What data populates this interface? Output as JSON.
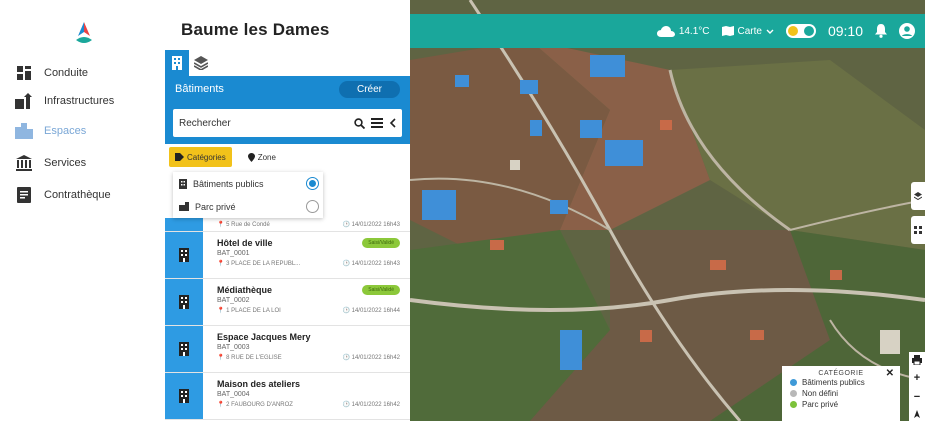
{
  "app": {
    "city": "Baume les Dames"
  },
  "nav": {
    "items": [
      {
        "label": "Conduite",
        "icon": "steering-icon"
      },
      {
        "label": "Infrastructures",
        "icon": "infrastructure-icon"
      },
      {
        "label": "Espaces",
        "icon": "spaces-icon",
        "active": true
      },
      {
        "label": "Services",
        "icon": "services-icon"
      },
      {
        "label": "Contrathèque",
        "icon": "contracts-icon"
      }
    ]
  },
  "panel": {
    "section_title": "Bâtiments",
    "create_label": "Créer",
    "search_placeholder": "Rechercher",
    "filters": {
      "categories": "Catégories",
      "zone": "Zone"
    },
    "dropdown": [
      {
        "label": "Bâtiments publics",
        "checked": true
      },
      {
        "label": "Parc privé",
        "checked": false
      }
    ],
    "first_item": {
      "addr": "5 Rue de Condé",
      "date": "14/01/2022 16h43"
    },
    "items": [
      {
        "name": "Hôtel de ville",
        "code": "BAT_0001",
        "addr": "3 PLACE DE LA REPUBL...",
        "date": "14/01/2022 16h43",
        "badge": "Saisi/Validé"
      },
      {
        "name": "Médiathèque",
        "code": "BAT_0002",
        "addr": "1 PLACE DE LA LOI",
        "date": "14/01/2022 16h44",
        "badge": "Saisi/Validé"
      },
      {
        "name": "Espace Jacques Mery",
        "code": "BAT_0003",
        "addr": "8 RUE DE L'EGLISE",
        "date": "14/01/2022 16h42",
        "badge": ""
      },
      {
        "name": "Maison des ateliers",
        "code": "BAT_0004",
        "addr": "2 FAUBOURG D'ANROZ",
        "date": "14/01/2022 16h42",
        "badge": ""
      }
    ]
  },
  "topbar": {
    "temperature": "14.1°C",
    "map_select": "Carte",
    "time": "09:10"
  },
  "legend": {
    "title": "CATÉGORIE",
    "items": [
      {
        "label": "Bâtiments publics",
        "color": "#3f9ad8"
      },
      {
        "label": "Non défini",
        "color": "#b8b8b8"
      },
      {
        "label": "Parc privé",
        "color": "#7cc23a"
      }
    ]
  },
  "colors": {
    "primary": "#1a8ad1",
    "teal": "#1aa79b",
    "accent": "#f2c21a"
  }
}
